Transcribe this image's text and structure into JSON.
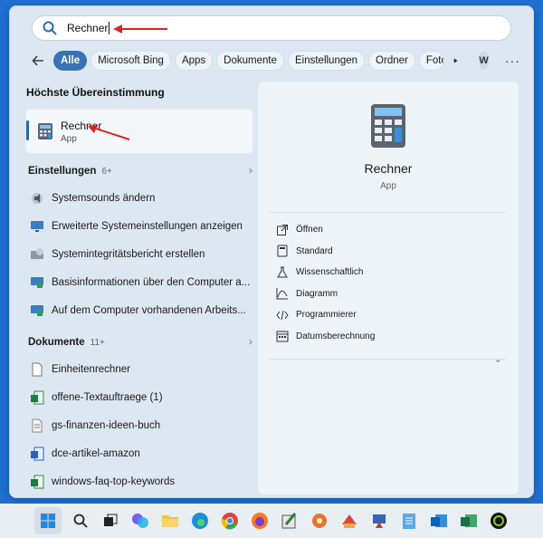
{
  "search": {
    "value": "Rechner"
  },
  "filters": [
    "Alle",
    "Microsoft Bing",
    "Apps",
    "Dokumente",
    "Einstellungen",
    "Ordner",
    "Foto"
  ],
  "account_initial": "W",
  "more_label": "···",
  "best_match": {
    "title": "Höchste Übereinstimmung",
    "name": "Rechner",
    "type": "App"
  },
  "settings_group": {
    "title": "Einstellungen",
    "count": "6+",
    "items": [
      {
        "label": "Systemsounds ändern",
        "icon": "speaker-icon"
      },
      {
        "label": "Erweiterte Systemeinstellungen anzeigen",
        "icon": "monitor-settings-icon"
      },
      {
        "label": "Systemintegritätsbericht erstellen",
        "icon": "system-report-icon"
      },
      {
        "label": "Basisinformationen über den Computer a...",
        "icon": "computer-info-icon"
      },
      {
        "label": "Auf dem Computer vorhandenen Arbeits...",
        "icon": "computer-info-icon"
      }
    ]
  },
  "documents_group": {
    "title": "Dokumente",
    "count": "11+",
    "items": [
      {
        "label": "Einheitenrechner",
        "icon": "document-icon"
      },
      {
        "label": "offene-Textauftraege (1)",
        "icon": "spreadsheet-icon"
      },
      {
        "label": "gs-finanzen-ideen-buch",
        "icon": "text-document-icon"
      },
      {
        "label": "dce-artikel-amazon",
        "icon": "word-document-icon"
      },
      {
        "label": "windows-faq-top-keywords",
        "icon": "spreadsheet-icon"
      }
    ]
  },
  "preview": {
    "name": "Rechner",
    "type": "App",
    "actions": [
      "Öffnen",
      "Standard",
      "Wissenschaftlich",
      "Diagramm",
      "Programmierer",
      "Datumsberechnung"
    ]
  },
  "colors": {
    "accent": "#3a72b4",
    "arrow": "#d9232a"
  }
}
